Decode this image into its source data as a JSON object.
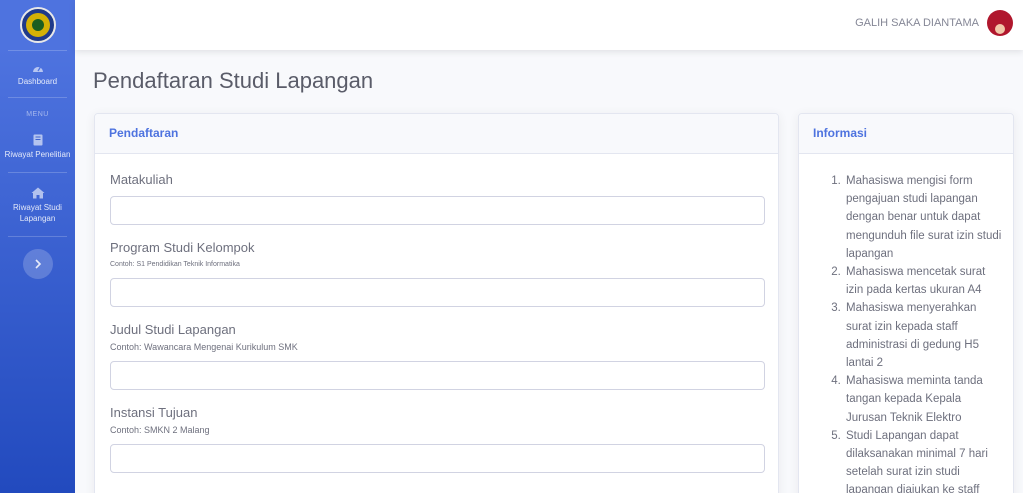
{
  "sidebar": {
    "dashboard_label": "Dashboard",
    "menu_heading": "MENU",
    "items": [
      {
        "label": "Riwayat Penelitian",
        "icon": "book-icon"
      },
      {
        "label": "Riwayat Studi Lapangan",
        "icon": "home-icon"
      }
    ],
    "toggle_icon": "chevron-right-icon"
  },
  "topbar": {
    "user_name": "GALIH SAKA DIANTAMA"
  },
  "page_title": "Pendaftaran Studi Lapangan",
  "form": {
    "header": "Pendaftaran",
    "fields": [
      {
        "label": "Matakuliah",
        "hint": "",
        "value": ""
      },
      {
        "label": "Program Studi Kelompok",
        "hint": "Contoh: S1 Pendidikan Teknik Informatika",
        "value": ""
      },
      {
        "label": "Judul Studi Lapangan",
        "hint": "Contoh: Wawancara Mengenai Kurikulum SMK",
        "value": ""
      },
      {
        "label": "Instansi Tujuan",
        "hint": "Contoh: SMKN 2 Malang",
        "value": ""
      }
    ]
  },
  "info": {
    "header": "Informasi",
    "items": [
      "Mahasiswa mengisi form pengajuan studi lapangan dengan benar untuk dapat mengunduh file surat izin studi lapangan",
      "Mahasiswa mencetak surat izin pada kertas ukuran A4",
      "Mahasiswa menyerahkan surat izin kepada staff administrasi di gedung H5 lantai 2",
      "Mahasiswa meminta tanda tangan kepada Kepala Jurusan Teknik Elektro",
      "Studi Lapangan dapat dilaksanakan minimal 7 hari setelah surat izin studi lapangan diajukan ke staff"
    ]
  },
  "colors": {
    "primary": "#4e73df",
    "sidebar_gradient_end": "#224abe",
    "background": "#f8f9fc"
  }
}
